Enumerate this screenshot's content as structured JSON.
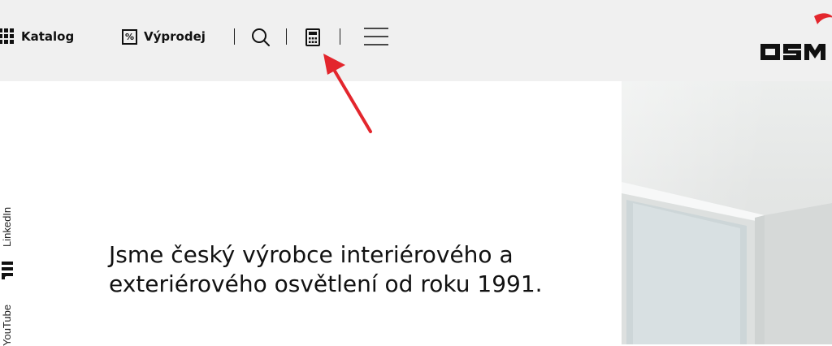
{
  "nav": {
    "catalog_label": "Katalog",
    "sale_label": "Výprodej",
    "sale_icon_symbol": "%",
    "icons": [
      "grid-icon",
      "percent-icon",
      "search-icon",
      "calculator-icon",
      "hamburger-menu-icon"
    ]
  },
  "logo": {
    "text": "OSM",
    "accent_color": "#e3262d"
  },
  "social": {
    "linkedin_label": "LinkedIn",
    "youtube_label": "YouTube"
  },
  "hero": {
    "headline": "Jsme český výrobce interiérového a exteriérového osvětlení od roku 1991."
  },
  "annotation": {
    "arrow_color": "#e3262d"
  },
  "colors": {
    "header_bg": "#f0f0f0",
    "text": "#111111",
    "accent": "#e3262d"
  }
}
